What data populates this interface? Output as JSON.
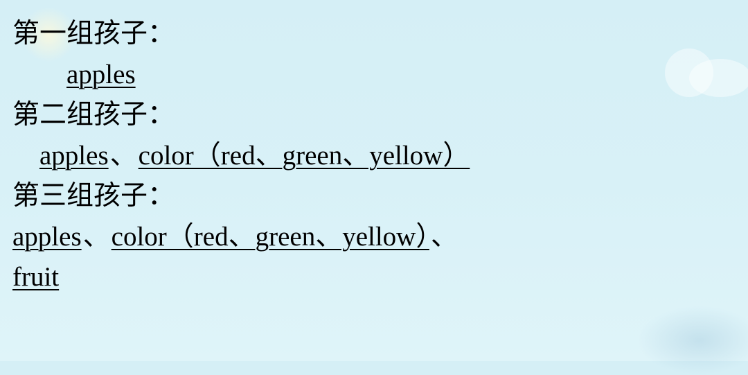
{
  "groups": [
    {
      "heading": "第一组孩子：",
      "items": [
        "apples"
      ],
      "indent": "indent-1"
    },
    {
      "heading": "第二组孩子：",
      "items": [
        "apples",
        "color（red、green、yellow）"
      ],
      "indent": "indent-2"
    },
    {
      "heading": "第三组孩子：",
      "items": [
        "apples",
        "color（red、green、yellow）",
        "fruit"
      ],
      "indent": "indent-0"
    }
  ],
  "sep": "、"
}
